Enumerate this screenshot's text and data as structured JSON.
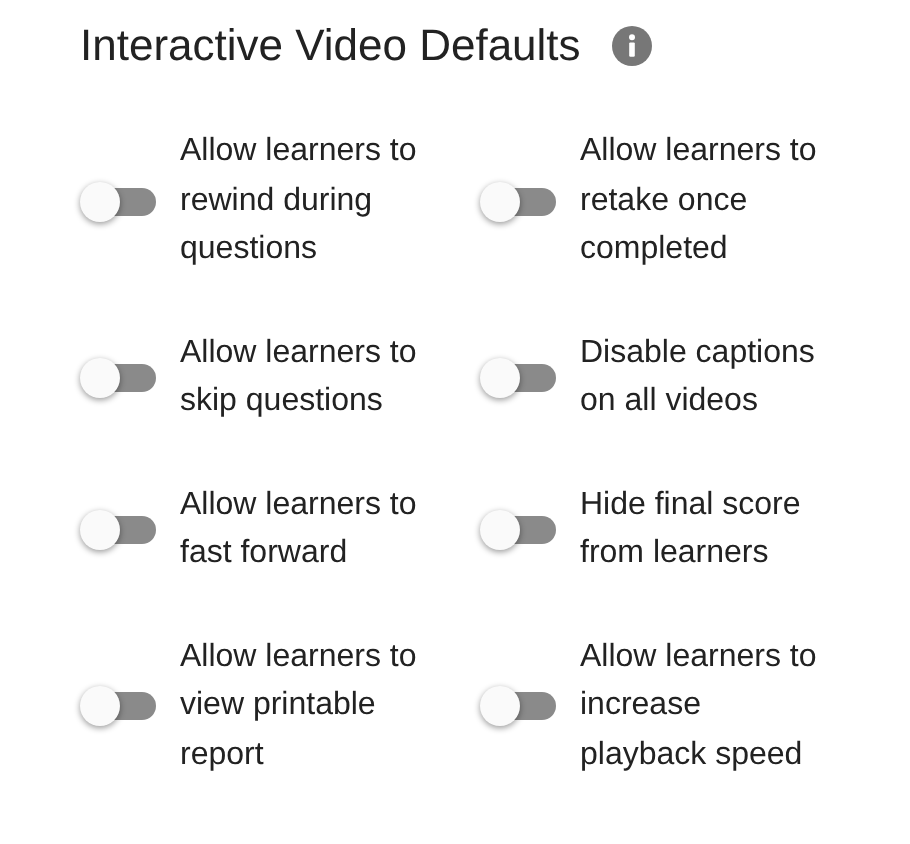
{
  "title": "Interactive Video Defaults",
  "settings": [
    {
      "label": "Allow learners to rewind during questions",
      "on": false
    },
    {
      "label": "Allow learners to retake once completed",
      "on": false
    },
    {
      "label": "Allow learners to skip questions",
      "on": false
    },
    {
      "label": "Disable captions on all videos",
      "on": false
    },
    {
      "label": "Allow learners to fast forward",
      "on": false
    },
    {
      "label": "Hide final score from learners",
      "on": false
    },
    {
      "label": "Allow learners to view printable report",
      "on": false
    },
    {
      "label": "Allow learners to increase playback speed",
      "on": false
    }
  ]
}
